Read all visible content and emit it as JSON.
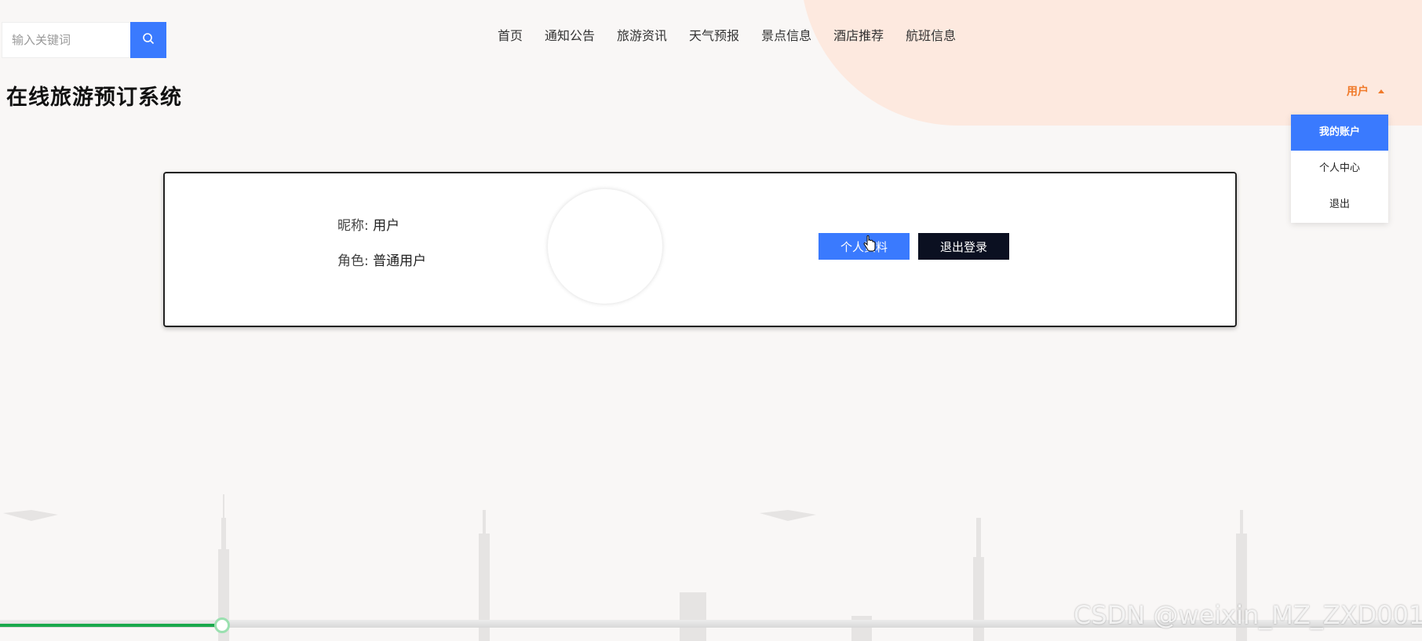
{
  "search": {
    "placeholder": "输入关键词",
    "icon": "search-icon"
  },
  "nav": {
    "items": [
      {
        "label": "首页"
      },
      {
        "label": "通知公告"
      },
      {
        "label": "旅游资讯"
      },
      {
        "label": "天气预报"
      },
      {
        "label": "景点信息"
      },
      {
        "label": "酒店推荐"
      },
      {
        "label": "航班信息"
      }
    ]
  },
  "site": {
    "title": "在线旅游预订系统"
  },
  "user_menu": {
    "label": "用户",
    "dropdown": [
      {
        "label": "我的账户",
        "active": true
      },
      {
        "label": "个人中心",
        "active": false
      },
      {
        "label": "退出",
        "active": false
      }
    ]
  },
  "profile": {
    "nickname_label": "昵称: ",
    "nickname": "用户",
    "role_label": "角色: ",
    "role": "普通用户",
    "profile_button": "个人资料",
    "logout_button": "退出登录"
  },
  "video": {
    "progress": 0.156
  },
  "watermark": "CSDN @weixin_MZ_ZXD001",
  "colors": {
    "primary": "#3a7afe",
    "accent": "#f07a2a",
    "dark_button": "#0b1021",
    "progress": "#1aa94c"
  }
}
